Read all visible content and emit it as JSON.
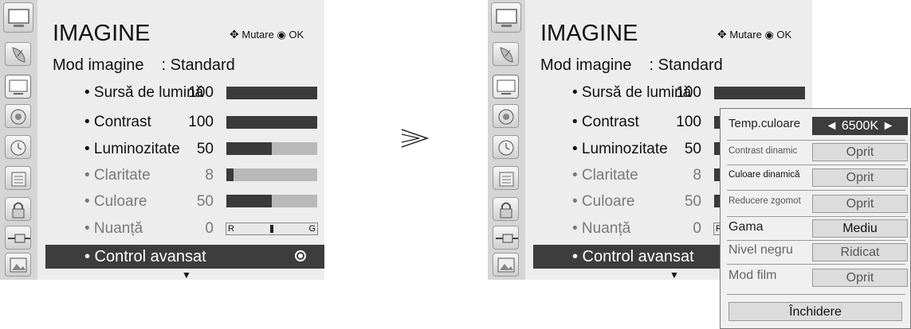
{
  "menu": {
    "title": "IMAGINE",
    "nav_hint": {
      "move_label": "Mutare",
      "ok_label": "OK"
    },
    "mode": {
      "label": "Mod imagine",
      "value": ": Standard"
    },
    "items": [
      {
        "label": "• Sursă de lumină",
        "value": "100",
        "level": 100,
        "enabled": true
      },
      {
        "label": "• Contrast",
        "value": "100",
        "level": 100,
        "enabled": true
      },
      {
        "label": "• Luminozitate",
        "value": "50",
        "level": 50,
        "enabled": true
      },
      {
        "label": "• Claritate",
        "value": "8",
        "level": 8,
        "enabled": false
      },
      {
        "label": "• Culoare",
        "value": "50",
        "level": 50,
        "enabled": false
      },
      {
        "label": "• Nuanță",
        "value": "0",
        "level": 0,
        "enabled": false,
        "bar_left": "R",
        "bar_right": "G"
      }
    ],
    "selected_item": "• Control avansat",
    "scroll_down": "▼"
  },
  "sidebar_icons": [
    "tv-icon",
    "satellite-dish-icon",
    "picture-icon",
    "audio-icon",
    "clock-icon",
    "options-icon",
    "lock-icon",
    "input-plug-icon",
    "photo-icon"
  ],
  "transition_arrow": "≫",
  "advanced_popup": {
    "rows": [
      {
        "label": "Temp.culoare",
        "value": "◄  6500K  ►"
      },
      {
        "label": "Contrast dinamic",
        "value": "Oprit"
      },
      {
        "label": "Culoare dinamică",
        "value": "Oprit"
      },
      {
        "label": "Reducere zgomot",
        "value": "Oprit"
      },
      {
        "label": "Gama",
        "value": "Mediu"
      },
      {
        "label": "Nivel negru",
        "value": "Ridicat"
      },
      {
        "label": "Mod film",
        "value": "Oprit"
      }
    ],
    "close_label": "Închidere"
  },
  "colors": {
    "highlight": "#3d3d3d",
    "panel": "#ededed",
    "bar_fill": "#3a3a3a",
    "bar_track": "#b9b9b9"
  }
}
